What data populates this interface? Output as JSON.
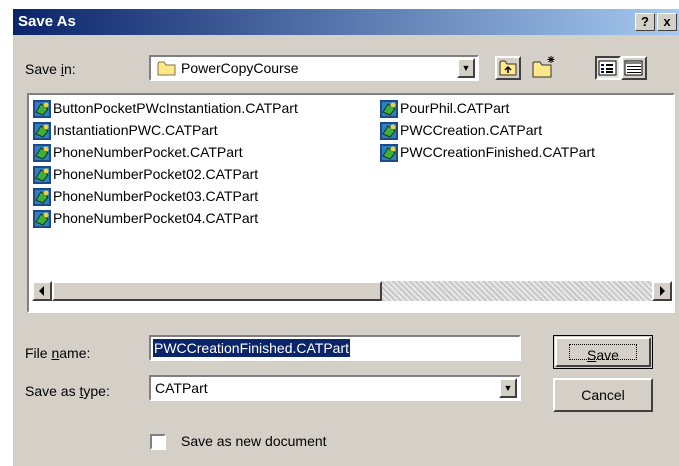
{
  "window": {
    "title": "Save As",
    "help_glyph": "?",
    "close_glyph": "x"
  },
  "save_in": {
    "label_prefix": "Save ",
    "label_key": "i",
    "label_suffix": "n:",
    "folder": "PowerCopyCourse"
  },
  "toolbar": {
    "icons": [
      "up-one-level-icon",
      "create-new-folder-icon",
      "list-view-icon",
      "details-view-icon"
    ]
  },
  "files": {
    "column1": [
      "ButtonPocketPWcInstantiation.CATPart",
      "InstantiationPWC.CATPart",
      "PhoneNumberPocket.CATPart",
      "PhoneNumberPocket02.CATPart",
      "PhoneNumberPocket03.CATPart",
      "PhoneNumberPocket04.CATPart"
    ],
    "column2": [
      "PourPhil.CATPart",
      "PWCCreation.CATPart",
      "PWCCreationFinished.CATPart"
    ]
  },
  "file_name": {
    "label_prefix": "File ",
    "label_key": "n",
    "label_suffix": "ame:",
    "value": "PWCCreationFinished.CATPart"
  },
  "save_as_type": {
    "label_prefix": "Save as ",
    "label_key": "t",
    "label_suffix": "ype:",
    "value": "CATPart"
  },
  "buttons": {
    "save_key": "S",
    "save_rest": "ave",
    "cancel": "Cancel"
  },
  "checkbox": {
    "label": "Save as new document",
    "checked": false
  },
  "colors": {
    "title_start": "#0a246a",
    "title_end": "#a6caf0",
    "selection": "#0a246a",
    "face": "#d4d0c8"
  }
}
